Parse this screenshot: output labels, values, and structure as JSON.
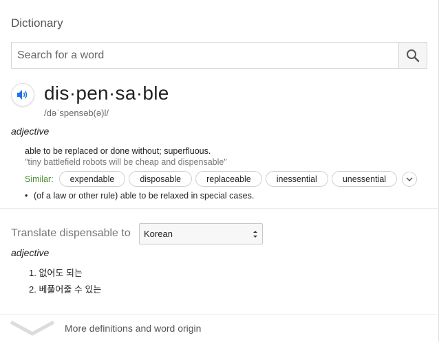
{
  "header": {
    "title": "Dictionary"
  },
  "search": {
    "placeholder": "Search for a word",
    "value": ""
  },
  "entry": {
    "word": "dis·pen·sa·ble",
    "phonetic": "/dəˈspensəb(ə)l/",
    "part_of_speech": "adjective",
    "senses": [
      {
        "definition": "able to be replaced or done without; superfluous.",
        "example": "\"tiny battlefield robots will be cheap and dispensable\"",
        "similar_label": "Similar:",
        "similar": [
          "expendable",
          "disposable",
          "replaceable",
          "inessential",
          "unessential"
        ]
      },
      {
        "definition": "(of a law or other rule) able to be relaxed in special cases."
      }
    ]
  },
  "translate": {
    "label": "Translate dispensable to",
    "language": "Korean",
    "part_of_speech": "adjective",
    "items": [
      "1. 없어도 되는",
      "2. 베풀어줄 수 있는"
    ]
  },
  "footer": {
    "more_label": "More definitions and word origin"
  },
  "icons": {
    "search": "search-icon",
    "speaker": "speaker-icon",
    "expand": "chevron-down-icon"
  },
  "colors": {
    "accent_blue": "#1a73e8",
    "similar_green": "#4b8a2f"
  }
}
